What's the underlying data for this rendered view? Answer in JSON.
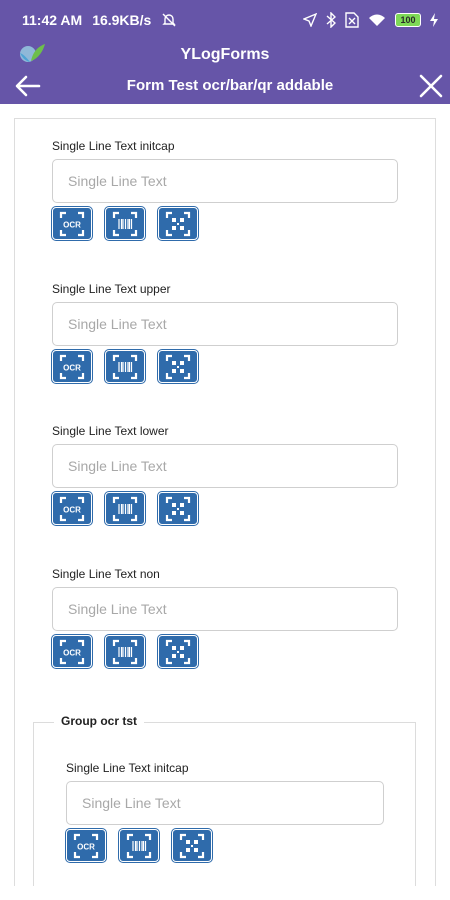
{
  "status_bar": {
    "time": "11:42 AM",
    "network_speed": "16.9KB/s",
    "battery_level": "100",
    "icons": [
      "mute-icon",
      "location-icon",
      "bluetooth-icon",
      "no-sim-icon",
      "wifi-icon",
      "battery-icon",
      "charging-icon"
    ]
  },
  "app_bar": {
    "app_title": "YLogForms",
    "form_title": "Form Test ocr/bar/qr addable",
    "color": "#6655a8"
  },
  "fields": [
    {
      "label": "Single Line Text initcap",
      "placeholder": "Single Line Text",
      "value": ""
    },
    {
      "label": "Single Line Text upper",
      "placeholder": "Single Line Text",
      "value": ""
    },
    {
      "label": "Single Line Text lower",
      "placeholder": "Single Line Text",
      "value": ""
    },
    {
      "label": "Single Line Text non",
      "placeholder": "Single Line Text",
      "value": ""
    }
  ],
  "group": {
    "title": "Group ocr tst",
    "fields": [
      {
        "label": "Single Line Text initcap",
        "placeholder": "Single Line Text",
        "value": ""
      }
    ]
  },
  "scan_buttons": {
    "ocr_icon_text": "OCR",
    "icons": [
      "ocr-scan-icon",
      "barcode-scan-icon",
      "qr-scan-icon"
    ],
    "color": "#2f6bab"
  }
}
